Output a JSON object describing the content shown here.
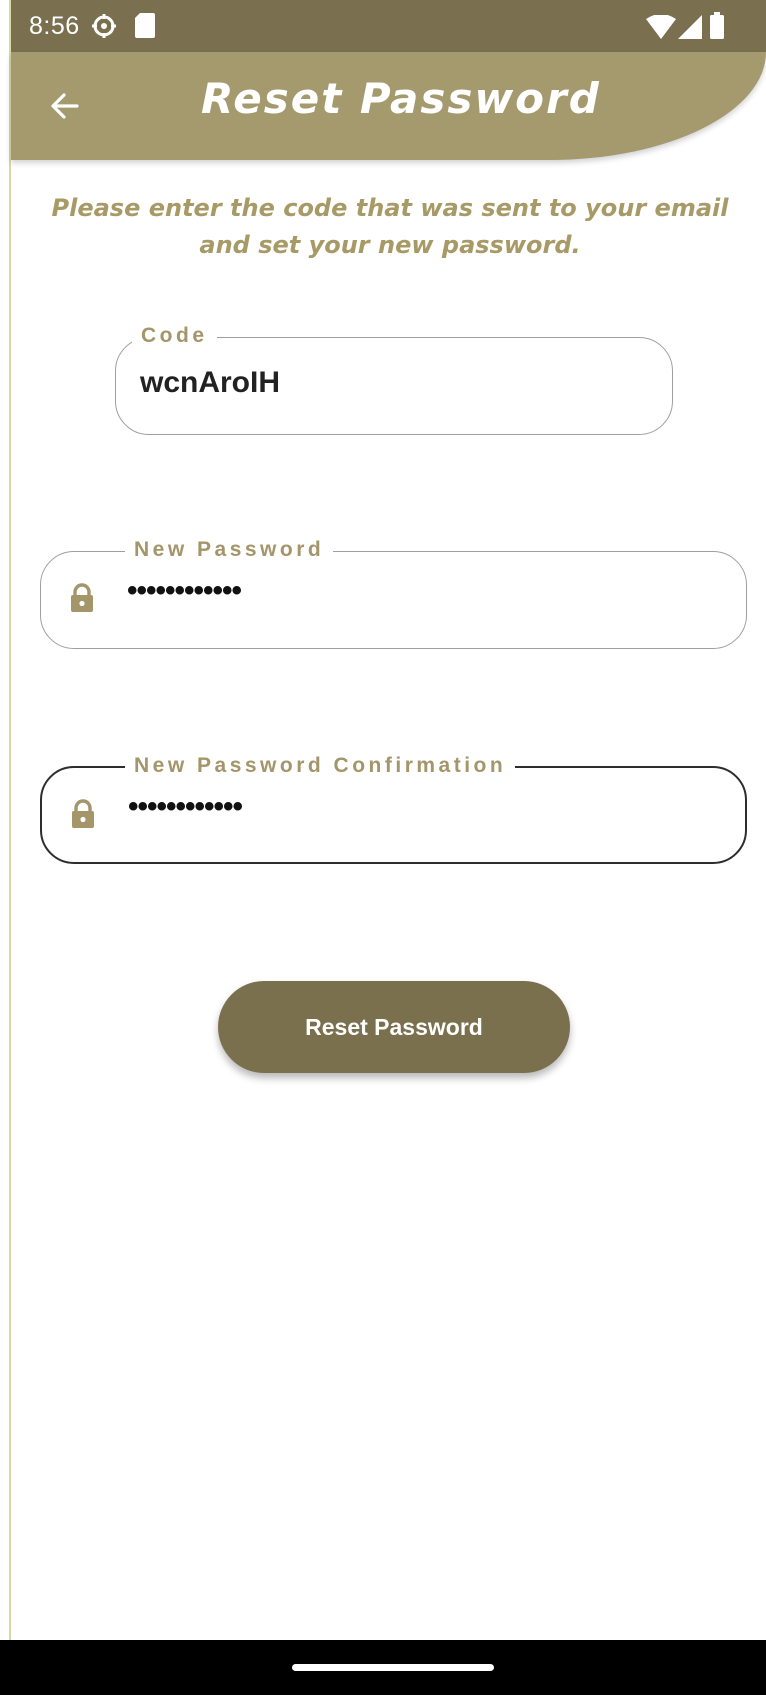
{
  "status_bar": {
    "time": "8:56",
    "icons": [
      "settings-gear-icon",
      "sd-card-icon",
      "wifi-icon",
      "cell-signal-icon",
      "battery-icon"
    ]
  },
  "header": {
    "title": "Reset Password",
    "back_icon": "arrow-back-icon",
    "background_color": "#a49a6e"
  },
  "instruction": {
    "text": "Please enter the code that was sent to your email and set your new password."
  },
  "form": {
    "code": {
      "label": "Code",
      "value": "wcnAroIH"
    },
    "new_password": {
      "label": "New Password",
      "value": "••••••••••••",
      "icon": "lock-icon"
    },
    "new_password_confirmation": {
      "label": "New Password Confirmation",
      "value": "••••••••••••",
      "icon": "lock-icon",
      "focused": true
    }
  },
  "button": {
    "label": "Reset Password",
    "color": "#7b704e"
  },
  "colors": {
    "status_bar": "#7a7050",
    "accent_text": "#a89a66",
    "label_text": "#a4956a"
  }
}
